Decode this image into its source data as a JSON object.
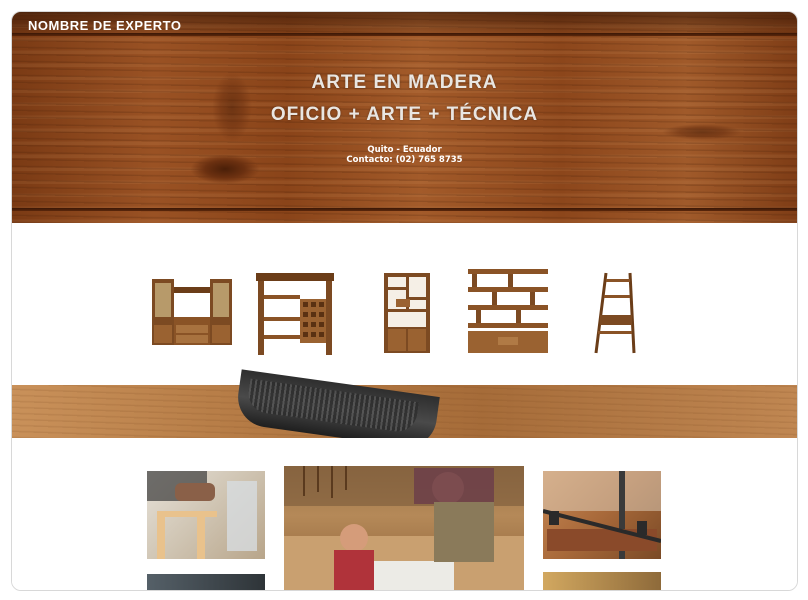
{
  "header": {
    "brand": "NOMBRE DE EXPERTO",
    "title_line1": "ARTE EN MADERA",
    "title_line2": "OFICIO + ARTE + TÉCNICA",
    "location": "Quito - Ecuador",
    "contact": "Contacto: (02) 765 8735"
  },
  "furniture": [
    {
      "icon": "wall-unit-icon"
    },
    {
      "icon": "wine-cabinet-icon"
    },
    {
      "icon": "bookcase-icon"
    },
    {
      "icon": "open-shelf-icon"
    },
    {
      "icon": "ladder-shelf-icon"
    }
  ],
  "colors": {
    "wood": "#8a5326",
    "wood_dark": "#6b3d18",
    "hero_text": "#e9e6e2",
    "frame_border": "#d8d8d8"
  }
}
